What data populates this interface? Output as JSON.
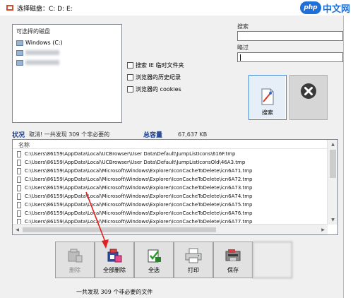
{
  "window": {
    "title": "选择磁盘：C: D: E:"
  },
  "watermark": {
    "logo": "php",
    "text": "中文网"
  },
  "drives": {
    "caption": "可选择的磁盘",
    "items": [
      {
        "label": "Windows (C:)"
      }
    ]
  },
  "options": [
    {
      "label": "搜索 IE 临时文件夹"
    },
    {
      "label": "浏览器的历史纪录"
    },
    {
      "label": "浏览器的 cookies"
    }
  ],
  "search": {
    "label": "搜索",
    "value": ""
  },
  "skip": {
    "label": "略过",
    "value": ""
  },
  "buttons": {
    "search_label": "搜索"
  },
  "status": {
    "state_key": "状况",
    "state_value": "取消! 一共发现 309 个非必要的",
    "total_key": "总容量",
    "total_value": "67,637 KB"
  },
  "file_list": {
    "header": "名称",
    "rows": [
      "C:\\Users\\86159\\AppData\\Local\\UCBrowser\\User Data\\Default\\JumpListIcons\\616F.tmp",
      "C:\\Users\\86159\\AppData\\Local\\UCBrowser\\User Data\\Default\\JumpListIconsOld\\46A3.tmp",
      "C:\\Users\\86159\\AppData\\Local\\Microsoft\\Windows\\Explorer\\IconCacheToDelete\\icn6A71.tmp",
      "C:\\Users\\86159\\AppData\\Local\\Microsoft\\Windows\\Explorer\\IconCacheToDelete\\icn6A72.tmp",
      "C:\\Users\\86159\\AppData\\Local\\Microsoft\\Windows\\Explorer\\IconCacheToDelete\\icn6A73.tmp",
      "C:\\Users\\86159\\AppData\\Local\\Microsoft\\Windows\\Explorer\\IconCacheToDelete\\icn6A74.tmp",
      "C:\\Users\\86159\\AppData\\Local\\Microsoft\\Windows\\Explorer\\IconCacheToDelete\\icn6A75.tmp",
      "C:\\Users\\86159\\AppData\\Local\\Microsoft\\Windows\\Explorer\\IconCacheToDelete\\icn6A76.tmp",
      "C:\\Users\\86159\\AppData\\Local\\Microsoft\\Windows\\Explorer\\IconCacheToDelete\\icn6A77.tmp"
    ]
  },
  "toolbar": {
    "delete_label": "删除",
    "delete_all_label": "全部删除",
    "select_all_label": "全选",
    "print_label": "打印",
    "save_label": "保存"
  },
  "bottom_status": "一共发现 309 个非必要的文件",
  "colors": {
    "accent": "#3c7fd1",
    "status_key": "#1a3c8c",
    "arrow": "#e02020"
  }
}
